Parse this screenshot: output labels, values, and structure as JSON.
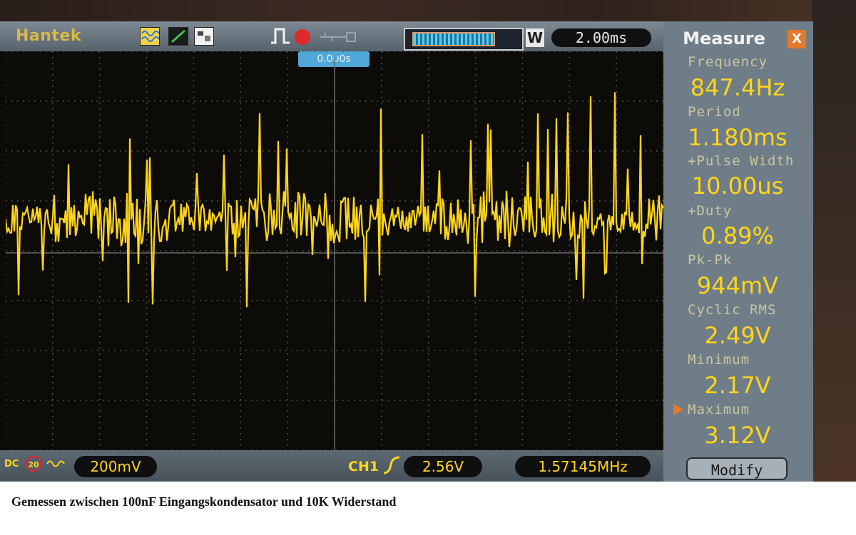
{
  "header": {
    "brand": "Hantek",
    "time_div": "2.00ms",
    "mode_label": "W",
    "trigger_position": "0.000s"
  },
  "measure": {
    "title": "Measure",
    "close_label": "X",
    "items": [
      {
        "label": "Frequency",
        "value": "847.4Hz"
      },
      {
        "label": "Period",
        "value": "1.180ms"
      },
      {
        "label": "+Pulse Width",
        "value": "10.00us"
      },
      {
        "label": "+Duty",
        "value": "0.89%"
      },
      {
        "label": "Pk-Pk",
        "value": "944mV"
      },
      {
        "label": "Cyclic RMS",
        "value": "2.49V"
      },
      {
        "label": "Minimum",
        "value": "2.17V"
      },
      {
        "label": "Maximum",
        "value": "3.12V"
      }
    ],
    "selected_item": "Maximum",
    "modify_label": "Modify"
  },
  "footer": {
    "coupling": "DC",
    "bw_limit": "20",
    "volts_div": "200mV",
    "trigger_source": "CH1",
    "trigger_level": "2.56V",
    "trigger_frequency": "1.57145MHz"
  },
  "caption": "Gemessen zwischen 100nF Eingangskondensator und 10K Widerstand",
  "colors": {
    "trace": "#ffd51a",
    "grid": "#5a5a5a",
    "panel": "#6f7d88",
    "accent": "#e57a2c"
  }
}
